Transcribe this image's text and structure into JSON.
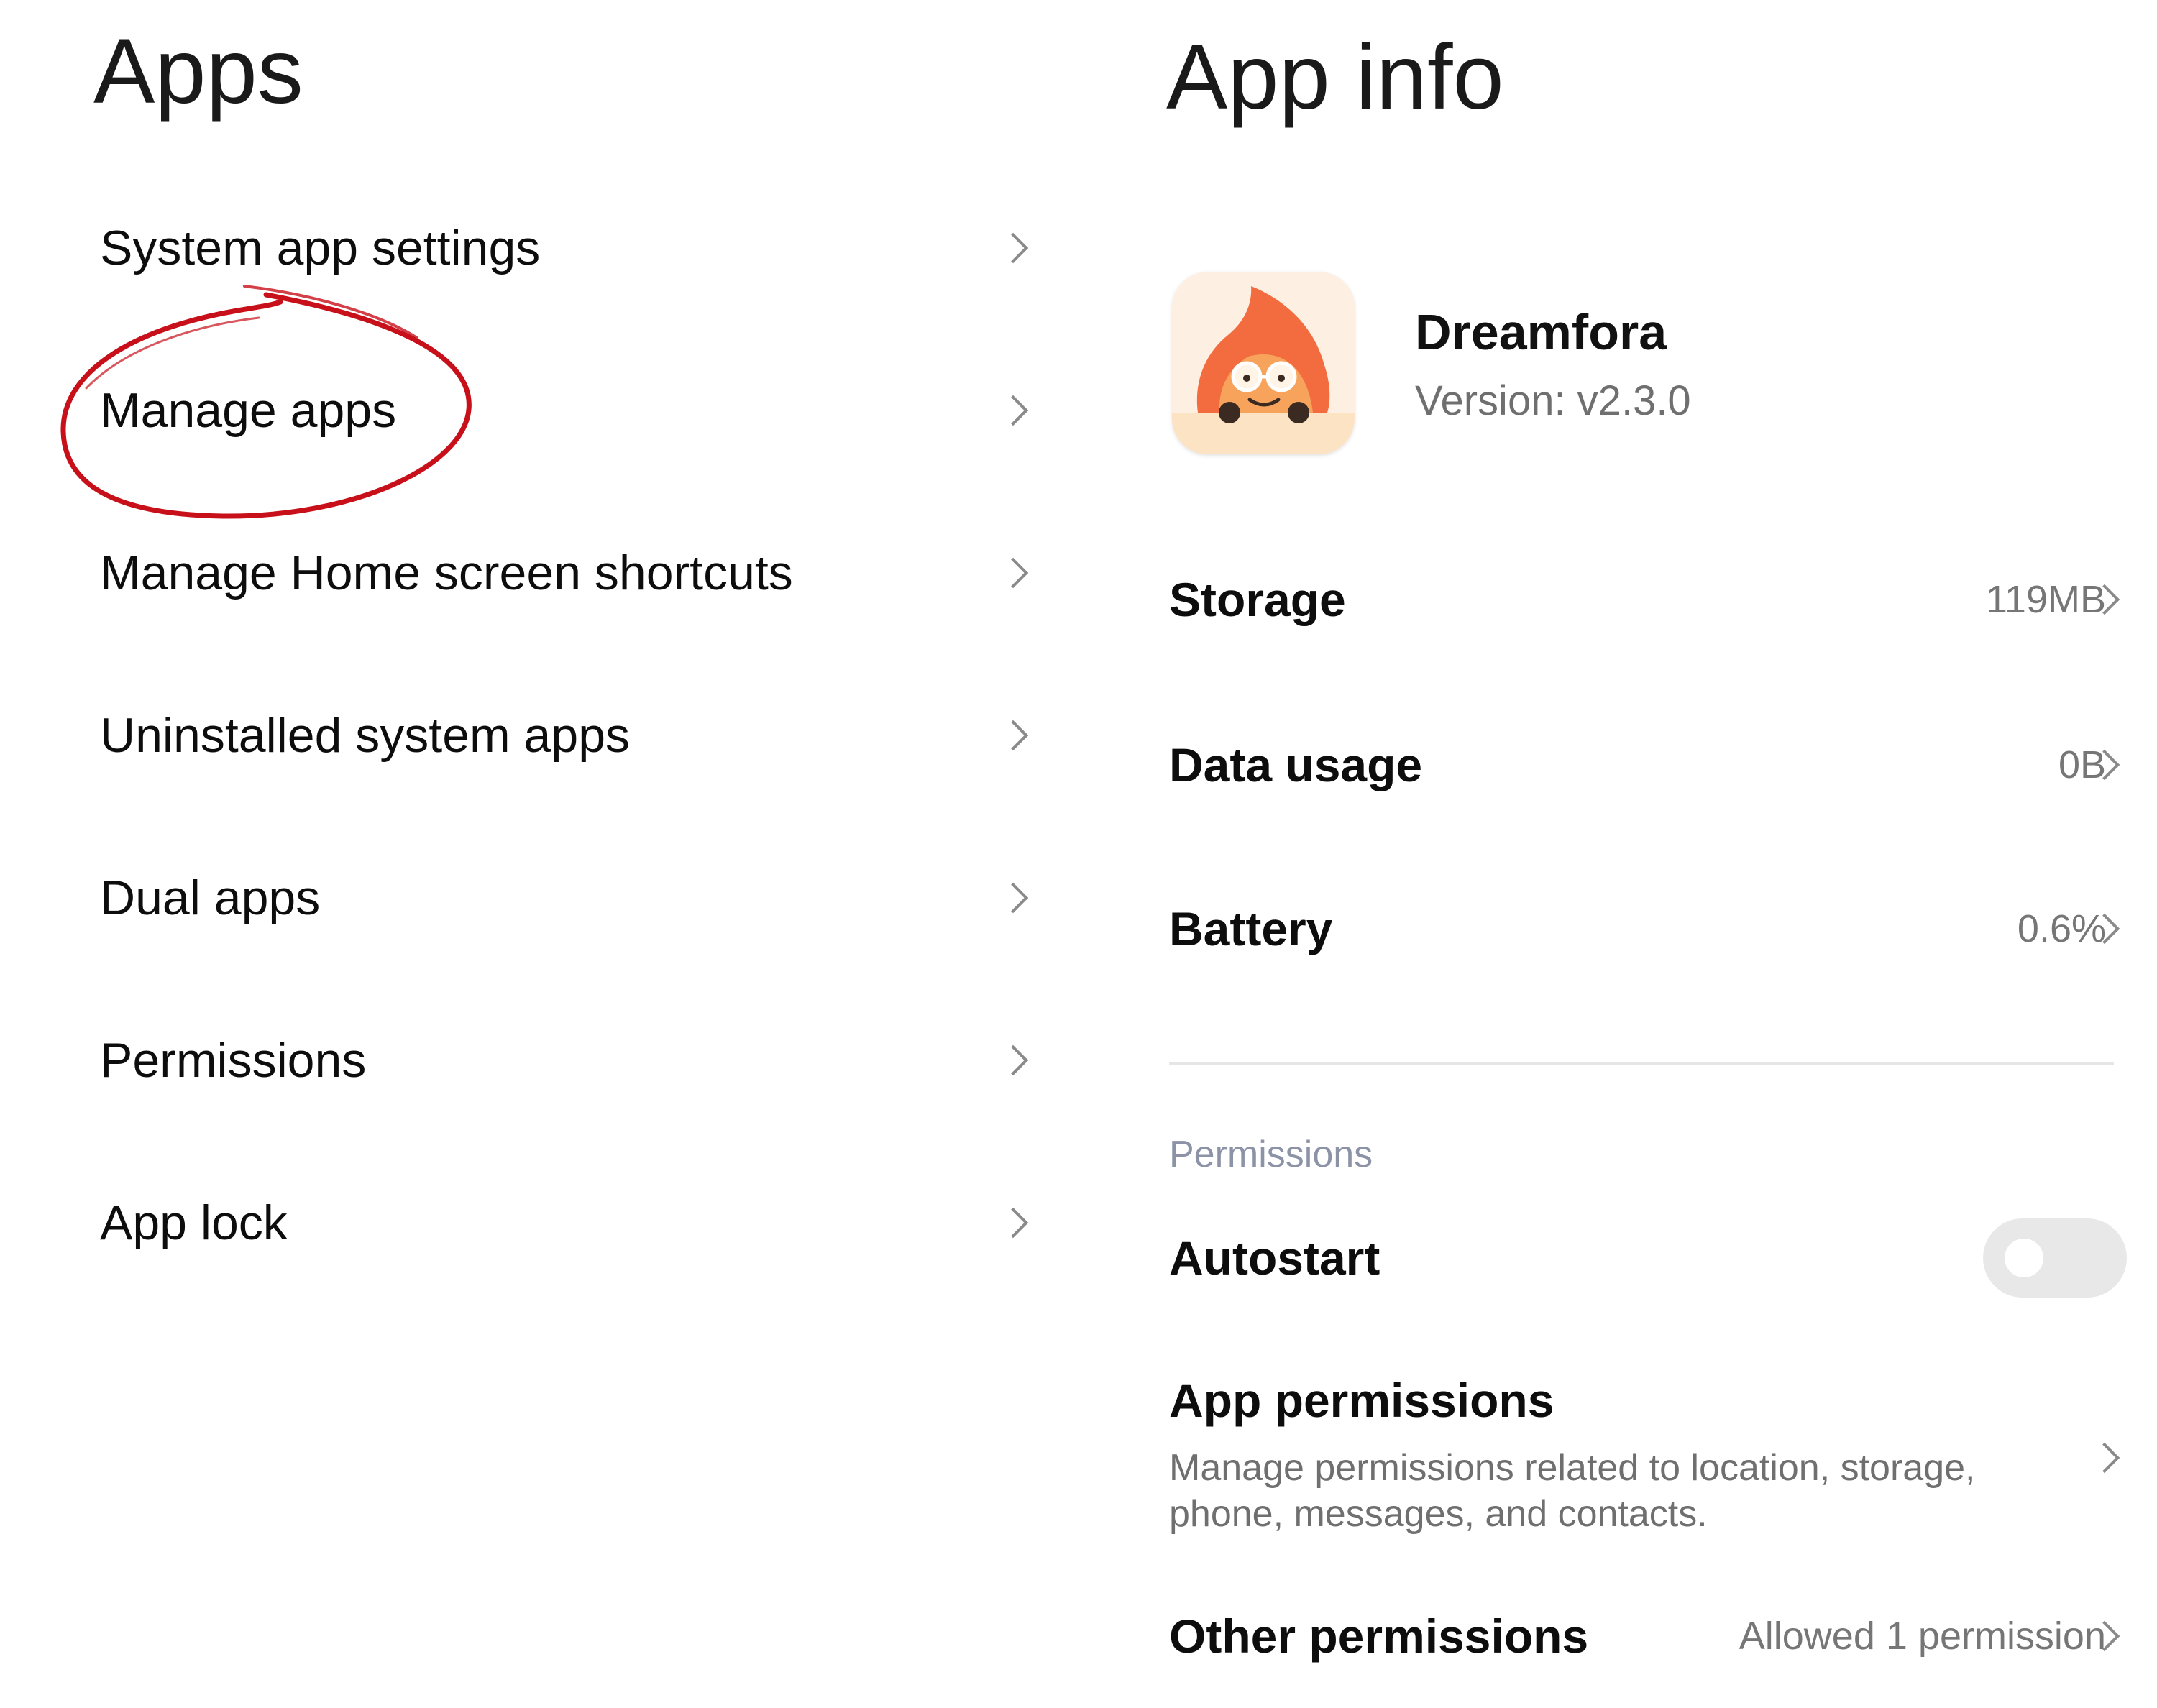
{
  "apps_panel": {
    "title": "Apps",
    "items": [
      {
        "label": "System app settings"
      },
      {
        "label": "Manage apps"
      },
      {
        "label": "Manage Home screen shortcuts"
      },
      {
        "label": "Uninstalled system apps"
      },
      {
        "label": "Dual apps"
      },
      {
        "label": "Permissions"
      },
      {
        "label": "App lock"
      }
    ],
    "annotation": {
      "target": "Manage apps",
      "color": "#c8101a",
      "shape": "hand-drawn circle"
    }
  },
  "app_info_panel": {
    "title": "App info",
    "app": {
      "name": "Dreamfora",
      "version": "Version: v2.3.0",
      "icon": "dreamfora-app-icon"
    },
    "rows": {
      "storage": {
        "label": "Storage",
        "value": "119MB"
      },
      "data_usage": {
        "label": "Data usage",
        "value": "0B"
      },
      "battery": {
        "label": "Battery",
        "value": "0.6%"
      }
    },
    "permissions_section": {
      "header": "Permissions",
      "autostart": {
        "label": "Autostart",
        "enabled": false
      },
      "app_permissions": {
        "title": "App permissions",
        "description": "Manage permissions related to location, storage, phone, messages, and contacts."
      },
      "other_permissions": {
        "label": "Other permissions",
        "value": "Allowed 1 permission"
      }
    }
  },
  "colors": {
    "background": "#ffffff",
    "primary_text": "#0d0d0d",
    "secondary_text": "#6f6f6f",
    "section_header": "#8c93a6",
    "annotation_red": "#c8101a",
    "toggle_off": "#e8e8e8",
    "icon_orange": "#f26c3f"
  }
}
